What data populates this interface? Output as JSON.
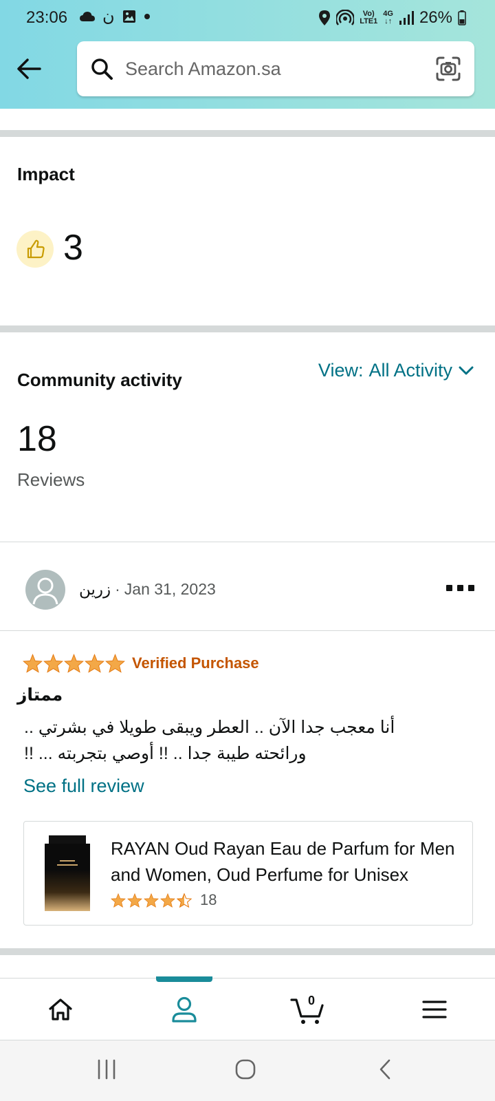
{
  "status_bar": {
    "time": "23:06",
    "battery": "26%",
    "network_top": "Vo)",
    "network_bottom": "LTE1",
    "signal_gen": "4G"
  },
  "search": {
    "placeholder": "Search Amazon.sa"
  },
  "impact": {
    "title": "Impact",
    "helpful_count": "3"
  },
  "community": {
    "title": "Community activity",
    "view_prefix": "View:",
    "view_value": "All Activity",
    "reviews_count": "18",
    "reviews_label": "Reviews"
  },
  "review": {
    "author": "زرين",
    "separator": "·",
    "date": "Jan 31, 2023",
    "rating": 5,
    "verified_label": "Verified Purchase",
    "title": "ممتاز",
    "body": "أنا معجب جدا الآن .. العطر ويبقى طويلا في بشرتي .. ورائحته طيبة جدا .. !! أوصي بتجربته ... !!",
    "see_full_label": "See full review"
  },
  "product": {
    "title": "RAYAN Oud Rayan Eau de Parfum for Men and Women, Oud Perfume for Unisex",
    "rating": 4.5,
    "rating_count": "18"
  },
  "bottom_nav": {
    "cart_count": "0",
    "active": "account"
  },
  "colors": {
    "accent": "#007185",
    "star": "#f3a847",
    "verified": "#c45500",
    "header_start": "#82d8e4",
    "header_end": "#a5e5db"
  }
}
